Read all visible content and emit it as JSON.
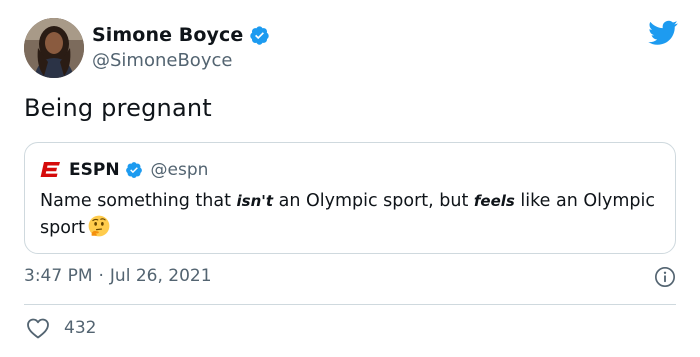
{
  "tweet": {
    "author": {
      "display_name": "Simone Boyce",
      "handle": "@SimoneBoyce",
      "verified": true,
      "avatar_icon": "profile-photo"
    },
    "text": "Being pregnant",
    "timestamp": {
      "time": "3:47 PM",
      "separator": "·",
      "date": "Jul 26, 2021"
    },
    "likes": "432",
    "brand_icon": "twitter-bird-icon",
    "colors": {
      "twitter_blue": "#1d9bf0",
      "espn_red": "#d50a0a",
      "secondary_text": "#536471",
      "border": "#cfd9de"
    }
  },
  "quoted_tweet": {
    "author": {
      "display_name": "ESPN",
      "handle": "@espn",
      "verified": true,
      "logo_icon": "espn-logo-icon"
    },
    "text_parts": {
      "p1": "Name something that ",
      "p2": "isn't",
      "p3": " an Olympic sport, but ",
      "p4": "feels",
      "p5": " like an Olympic sport"
    },
    "emoji_icon": "thinking-face-emoji"
  }
}
